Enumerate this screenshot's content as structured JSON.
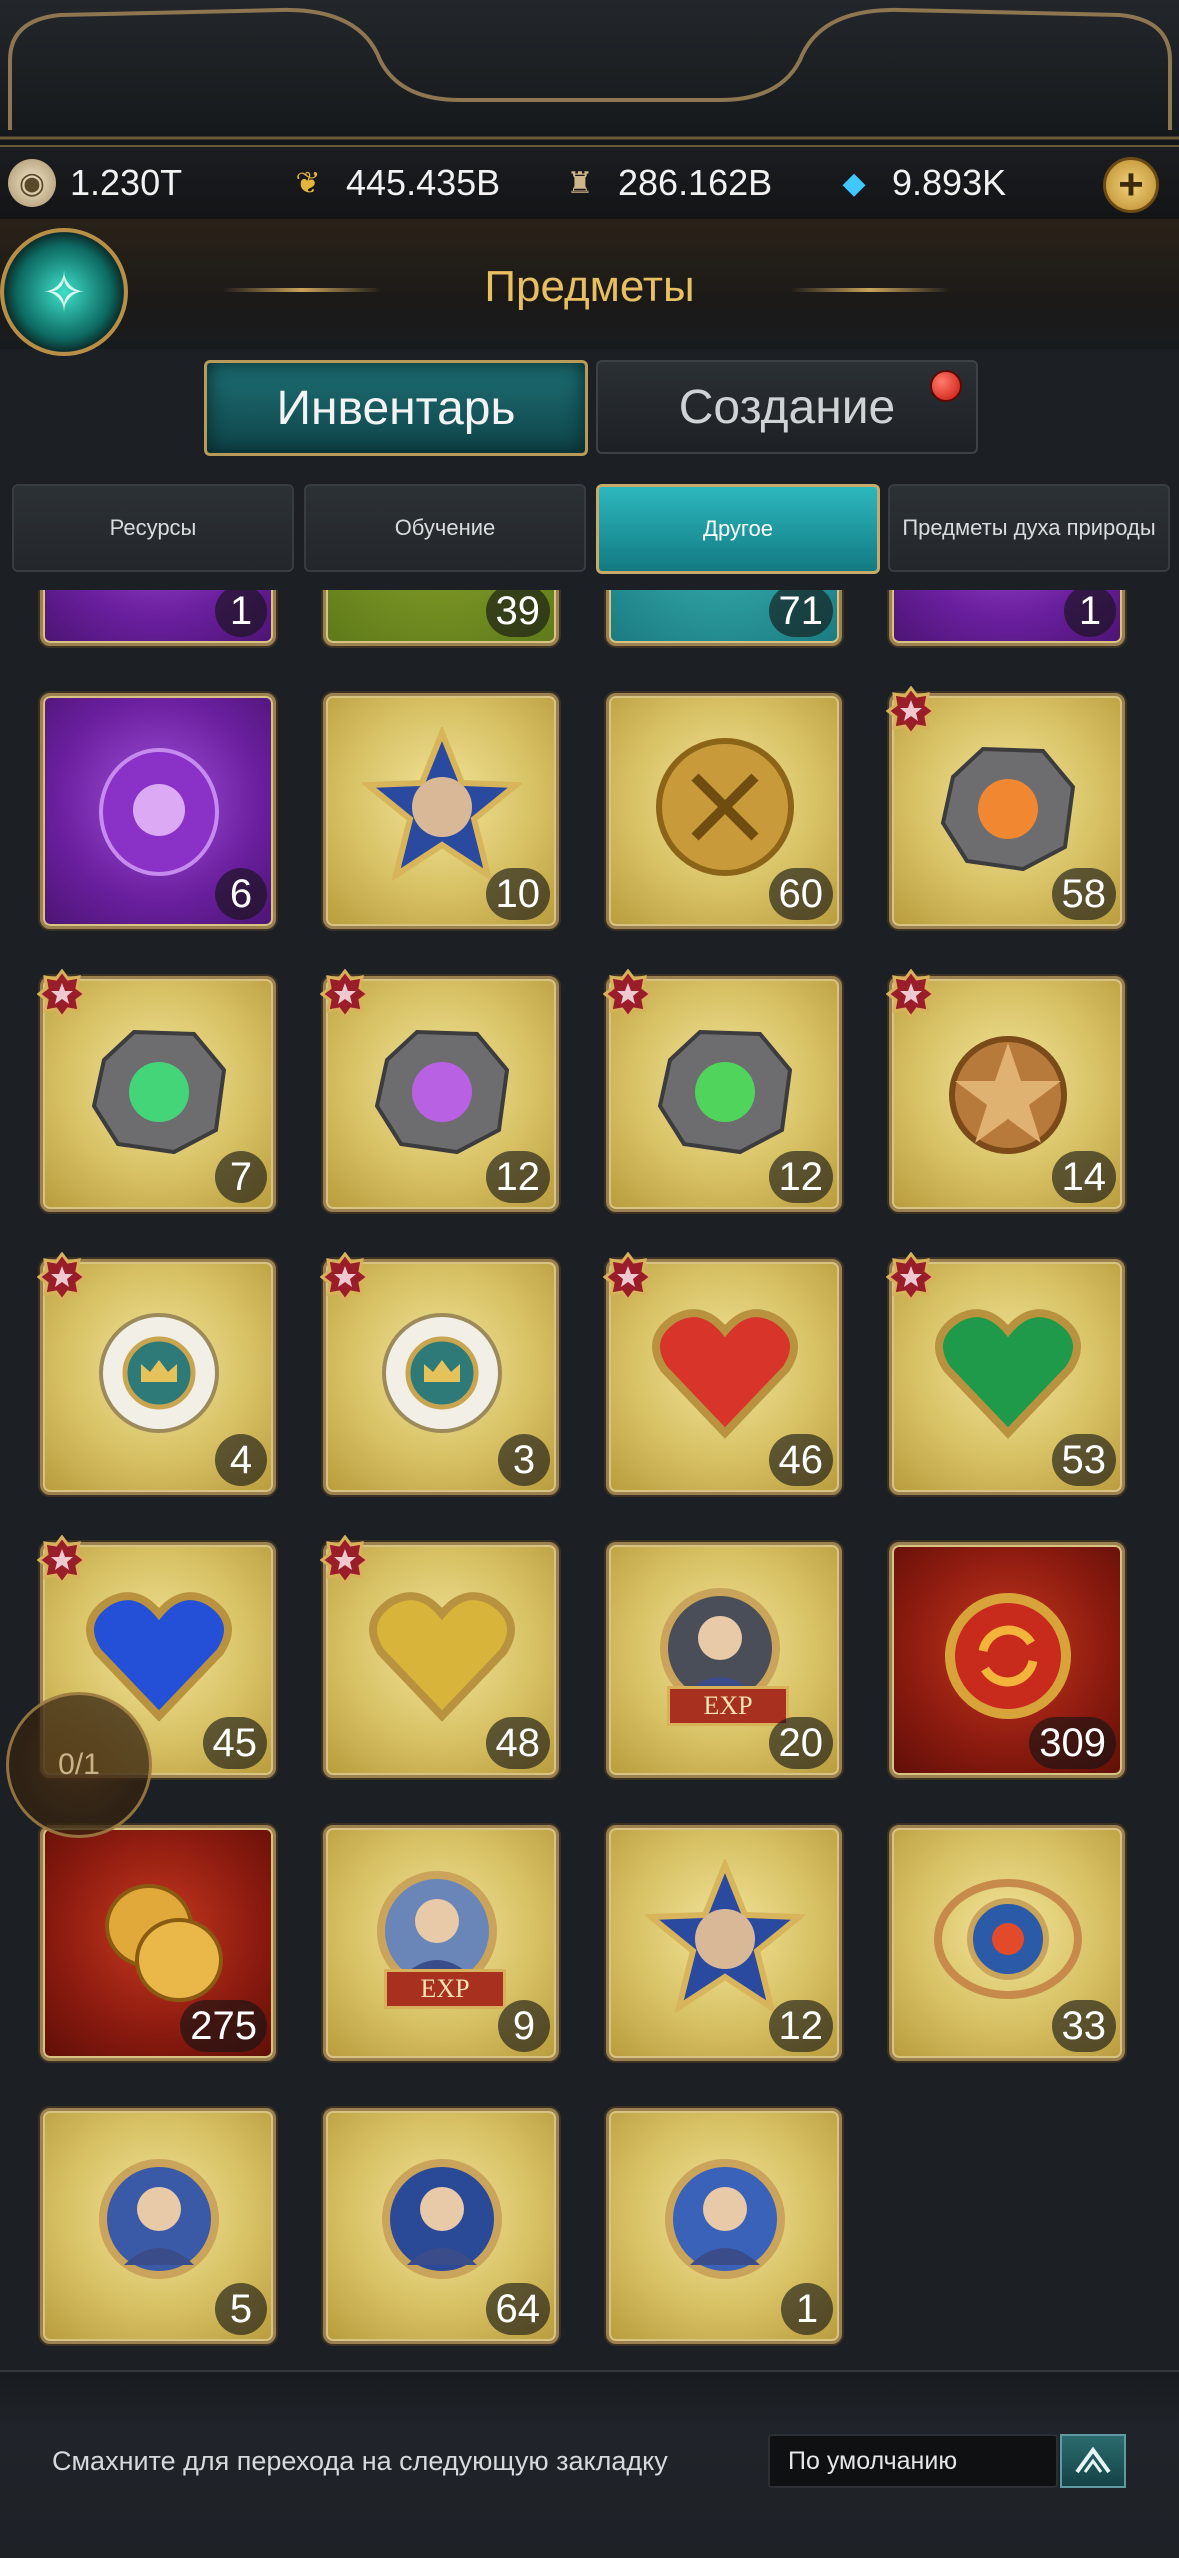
{
  "resources": [
    {
      "icon": "silver-coins-icon",
      "value": "1.230T"
    },
    {
      "icon": "wheat-icon",
      "value": "445.435B"
    },
    {
      "icon": "helmet-icon",
      "value": "286.162B"
    },
    {
      "icon": "diamond-icon",
      "value": "9.893K"
    }
  ],
  "header": {
    "title": "Предметы"
  },
  "main_tabs": [
    {
      "label": "Инвентарь",
      "active": true
    },
    {
      "label": "Создание",
      "active": false,
      "notification": true
    }
  ],
  "sub_tabs": [
    {
      "label": "Ресурсы",
      "active": false
    },
    {
      "label": "Обучение",
      "active": false
    },
    {
      "label": "Другое",
      "active": true
    },
    {
      "label": "Предметы духа природы",
      "active": false
    }
  ],
  "items": [
    {
      "count": "1",
      "bg": "purple",
      "icon": "scroll-icon",
      "badge": false
    },
    {
      "count": "39",
      "bg": "green",
      "icon": "scroll-icon",
      "badge": false
    },
    {
      "count": "71",
      "bg": "teal",
      "icon": "scroll-icon",
      "badge": false
    },
    {
      "count": "1",
      "bg": "purple",
      "icon": "scroll-icon",
      "badge": false
    },
    {
      "count": "6",
      "bg": "purple",
      "icon": "purple-spirit-stone-icon",
      "badge": false
    },
    {
      "count": "10",
      "bg": "gold",
      "icon": "hero-star-portrait-icon",
      "badge": false
    },
    {
      "count": "60",
      "bg": "gold",
      "icon": "gold-medal-coin-icon",
      "badge": false
    },
    {
      "count": "58",
      "bg": "gold",
      "icon": "crossed-swords-stone-icon",
      "badge": true
    },
    {
      "count": "7",
      "bg": "gold",
      "icon": "book-stone-icon",
      "badge": true
    },
    {
      "count": "12",
      "bg": "gold",
      "icon": "handshake-stone-icon",
      "badge": true
    },
    {
      "count": "12",
      "bg": "gold",
      "icon": "heart-stone-icon",
      "badge": true
    },
    {
      "count": "14",
      "bg": "gold",
      "icon": "bronze-star-badge-icon",
      "badge": true
    },
    {
      "count": "4",
      "bg": "gold",
      "icon": "crown-medallion-icon",
      "badge": true
    },
    {
      "count": "3",
      "bg": "gold",
      "icon": "crown-medallion-broken-icon",
      "badge": true
    },
    {
      "count": "46",
      "bg": "gold",
      "icon": "red-heart-swords-icon",
      "badge": true
    },
    {
      "count": "53",
      "bg": "gold",
      "icon": "green-heart-book-icon",
      "badge": true
    },
    {
      "count": "45",
      "bg": "gold",
      "icon": "blue-heart-handshake-icon",
      "badge": true
    },
    {
      "count": "48",
      "bg": "gold",
      "icon": "gold-heart-icon",
      "badge": true
    },
    {
      "count": "20",
      "bg": "gold",
      "icon": "exp-hero-portrait-icon",
      "badge": false,
      "label": "EXP"
    },
    {
      "count": "309",
      "bg": "red",
      "icon": "refresh-seal-icon",
      "badge": false
    },
    {
      "count": "275",
      "bg": "red",
      "icon": "gold-coins-icon",
      "badge": false
    },
    {
      "count": "9",
      "bg": "gold",
      "icon": "exp-heroine-portrait-icon",
      "badge": false,
      "label": "EXP"
    },
    {
      "count": "12",
      "bg": "gold",
      "icon": "heroine-star-portrait-icon",
      "badge": false
    },
    {
      "count": "33",
      "bg": "gold",
      "icon": "blue-orb-ring-icon",
      "badge": false
    },
    {
      "count": "5",
      "bg": "gold",
      "icon": "heroine-ring-portrait-icon",
      "badge": false
    },
    {
      "count": "64",
      "bg": "gold",
      "icon": "old-man-ring-portrait-icon",
      "badge": false
    },
    {
      "count": "1",
      "bg": "gold",
      "icon": "young-hero-ring-portrait-icon",
      "badge": false
    }
  ],
  "pager": {
    "text": "0/1"
  },
  "footer": {
    "hint": "Смахните для перехода на следующую закладку",
    "sort_value": "По умолчанию"
  },
  "colors": {
    "accent_gold": "#e8c062",
    "active_tab_teal": "#1d6f74",
    "background": "#1c2024"
  }
}
